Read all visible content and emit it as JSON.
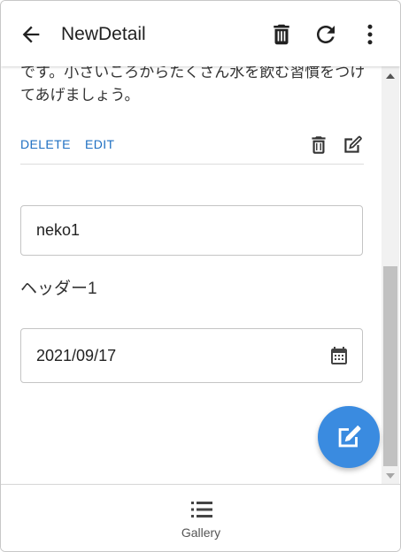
{
  "appbar": {
    "title": "NewDetail",
    "icons": [
      "arrow-left-icon",
      "trash-icon",
      "refresh-icon",
      "more-vert-icon"
    ]
  },
  "card": {
    "description": "です。小さいころからたくさん水を飲む習慣をつけてあげましょう。",
    "delete_label": "DELETE",
    "edit_label": "EDIT"
  },
  "form": {
    "name_value": "neko1",
    "header_text": "ヘッダー1",
    "date_value": "2021/09/17"
  },
  "bottom_nav": {
    "items": [
      {
        "label": "Gallery",
        "icon": "list-icon"
      }
    ]
  },
  "colors": {
    "accent": "#1e6fc2",
    "fab": "#3a8be0"
  }
}
